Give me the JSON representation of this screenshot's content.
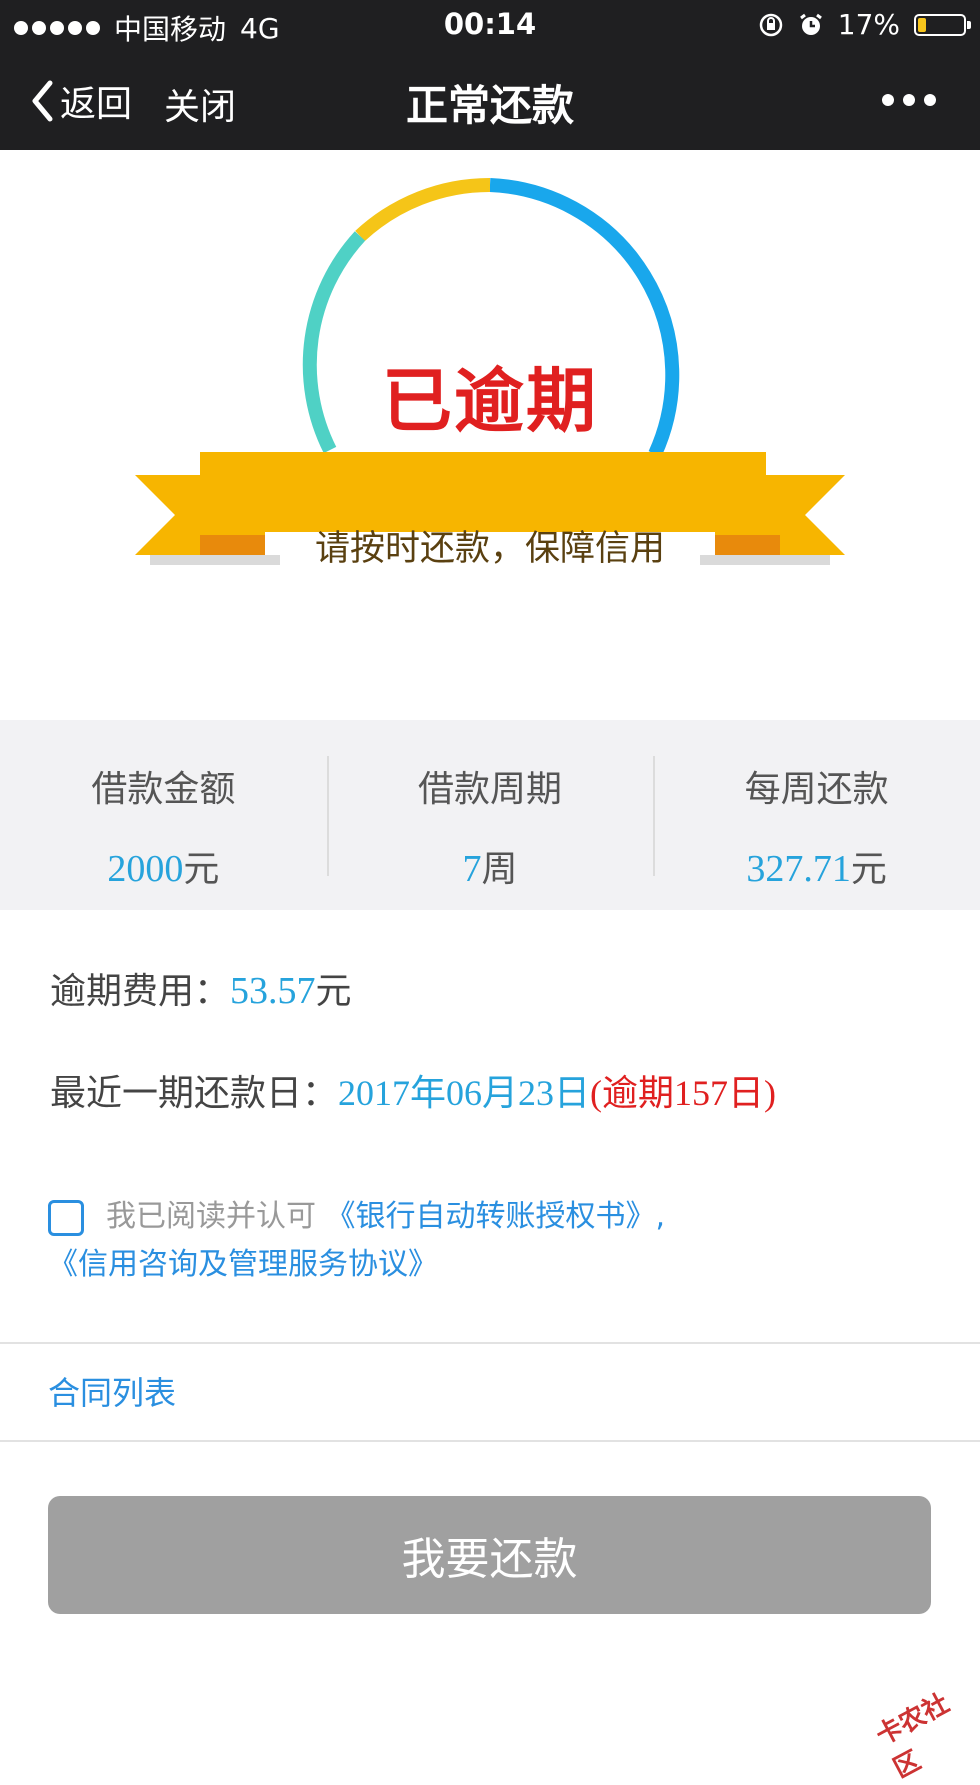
{
  "status_bar": {
    "carrier": "中国移动",
    "network": "4G",
    "time": "00:14",
    "battery": "17%"
  },
  "nav": {
    "back_label": "返回",
    "close_label": "关闭",
    "title": "正常还款"
  },
  "status": {
    "label": "已逾期",
    "banner": "请按时还款，保障信用"
  },
  "stats": [
    {
      "label": "借款金额",
      "value": "2000",
      "unit": "元"
    },
    {
      "label": "借款周期",
      "value": "7",
      "unit": "周"
    },
    {
      "label": "每周还款",
      "value": "327.71",
      "unit": "元"
    }
  ],
  "overdue_fee": {
    "label": "逾期费用：",
    "value": "53.57",
    "unit": "元"
  },
  "next_due": {
    "label": "最近一期还款日：",
    "date": "2017年06月23日",
    "overdue": "(逾期157日)"
  },
  "agreement": {
    "prefix": "我已阅读并认可",
    "link1": "《银行自动转账授权书》,",
    "link2": "《信用咨询及管理服务协议》"
  },
  "contract_list": "合同列表",
  "pay_button": "我要还款",
  "watermark": "卡农社区",
  "colors": {
    "accent": "#26a3dc",
    "danger": "#e02020",
    "banner": "#f7b500",
    "button_disabled": "#a0a0a0"
  }
}
